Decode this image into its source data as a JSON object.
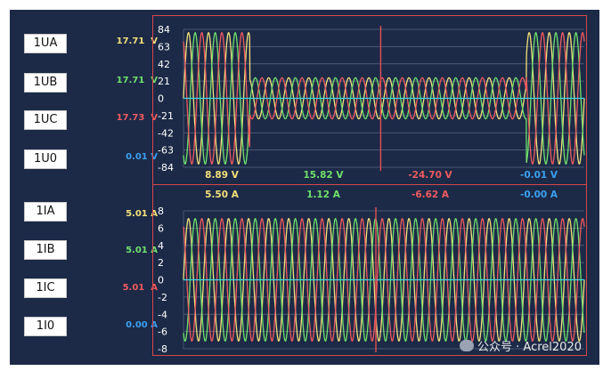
{
  "channels_voltage": [
    {
      "label": "1UA",
      "value": "17.71",
      "unit": "V",
      "color": "#f2e07a"
    },
    {
      "label": "1UB",
      "value": "17.71",
      "unit": "V",
      "color": "#6fe06c"
    },
    {
      "label": "1UC",
      "value": "17.73",
      "unit": "V",
      "color": "#f05a5f"
    },
    {
      "label": "1U0",
      "value": "0.01",
      "unit": "V",
      "color": "#3aa0f0"
    }
  ],
  "channels_current": [
    {
      "label": "1IA",
      "value": "5.01",
      "unit": "A",
      "color": "#f2e07a"
    },
    {
      "label": "1IB",
      "value": "5.01",
      "unit": "A",
      "color": "#6fe06c"
    },
    {
      "label": "1IC",
      "value": "5.01",
      "unit": "A",
      "color": "#f05a5f"
    },
    {
      "label": "1I0",
      "value": "0.00",
      "unit": "A",
      "color": "#3aa0f0"
    }
  ],
  "colors": {
    "background": "#1c2a47",
    "frame": "#d8474b",
    "cursor": "#e25055",
    "zero": "#3fd8e0",
    "phaseA": "#f2e07a",
    "phaseB": "#6fe06c",
    "phaseC": "#f05a5f",
    "zeroSeq": "#3aa0f0"
  },
  "cursor_voltage": [
    {
      "text": "8.89 V",
      "color": "#f2e07a"
    },
    {
      "text": "15.82 V",
      "color": "#6fe06c"
    },
    {
      "text": "-24.70 V",
      "color": "#f05a5f"
    },
    {
      "text": "-0.01 V",
      "color": "#3aa0f0"
    }
  ],
  "cursor_current": [
    {
      "text": "5.50 A",
      "color": "#f2e07a"
    },
    {
      "text": "1.12 A",
      "color": "#6fe06c"
    },
    {
      "text": "-6.62 A",
      "color": "#f05a5f"
    },
    {
      "text": "-0.00 A",
      "color": "#3aa0f0"
    }
  ],
  "chart_data": [
    {
      "type": "line",
      "title": "",
      "xlabel": "",
      "ylabel": "",
      "ylim": [
        -84,
        84
      ],
      "ytick_labels": [
        "84",
        "63",
        "42",
        "21",
        "0",
        "-21",
        "-42",
        "-63",
        "-84"
      ],
      "grid": true,
      "cursor_x_fraction": 0.492,
      "series": [
        {
          "name": "1UA",
          "amplitude": 80,
          "low_amplitude": 25,
          "phase_deg": 0,
          "color": "#f2e07a"
        },
        {
          "name": "1UB",
          "amplitude": 80,
          "low_amplitude": 25,
          "phase_deg": -120,
          "color": "#6fe06c"
        },
        {
          "name": "1UC",
          "amplitude": 80,
          "low_amplitude": 25,
          "phase_deg": 120,
          "color": "#f05a5f"
        },
        {
          "name": "1U0",
          "amplitude": 0,
          "phase_deg": 0,
          "color": "#3fd8e0"
        }
      ],
      "cycles": 20,
      "segments": [
        {
          "from": 0.0,
          "to": 0.165,
          "level": "high"
        },
        {
          "from": 0.165,
          "to": 0.855,
          "level": "low"
        },
        {
          "from": 0.855,
          "to": 1.0,
          "level": "high"
        }
      ]
    },
    {
      "type": "line",
      "title": "",
      "xlabel": "",
      "ylabel": "",
      "ylim": [
        -8,
        8
      ],
      "ytick_labels": [
        "8",
        "6",
        "4",
        "2",
        "0",
        "-2",
        "-4",
        "-6",
        "-8"
      ],
      "grid": true,
      "cursor_x_fraction": 0.48,
      "series": [
        {
          "name": "1IA",
          "amplitude": 7.1,
          "phase_deg": 0,
          "color": "#f2e07a"
        },
        {
          "name": "1IB",
          "amplitude": 7.1,
          "phase_deg": -120,
          "color": "#6fe06c"
        },
        {
          "name": "1IC",
          "amplitude": 7.1,
          "phase_deg": 120,
          "color": "#f05a5f"
        },
        {
          "name": "1I0",
          "amplitude": 0,
          "phase_deg": 0,
          "color": "#3fd8e0"
        }
      ],
      "cycles": 20
    }
  ],
  "watermark": {
    "text": "公众号 · Acrel2020"
  }
}
